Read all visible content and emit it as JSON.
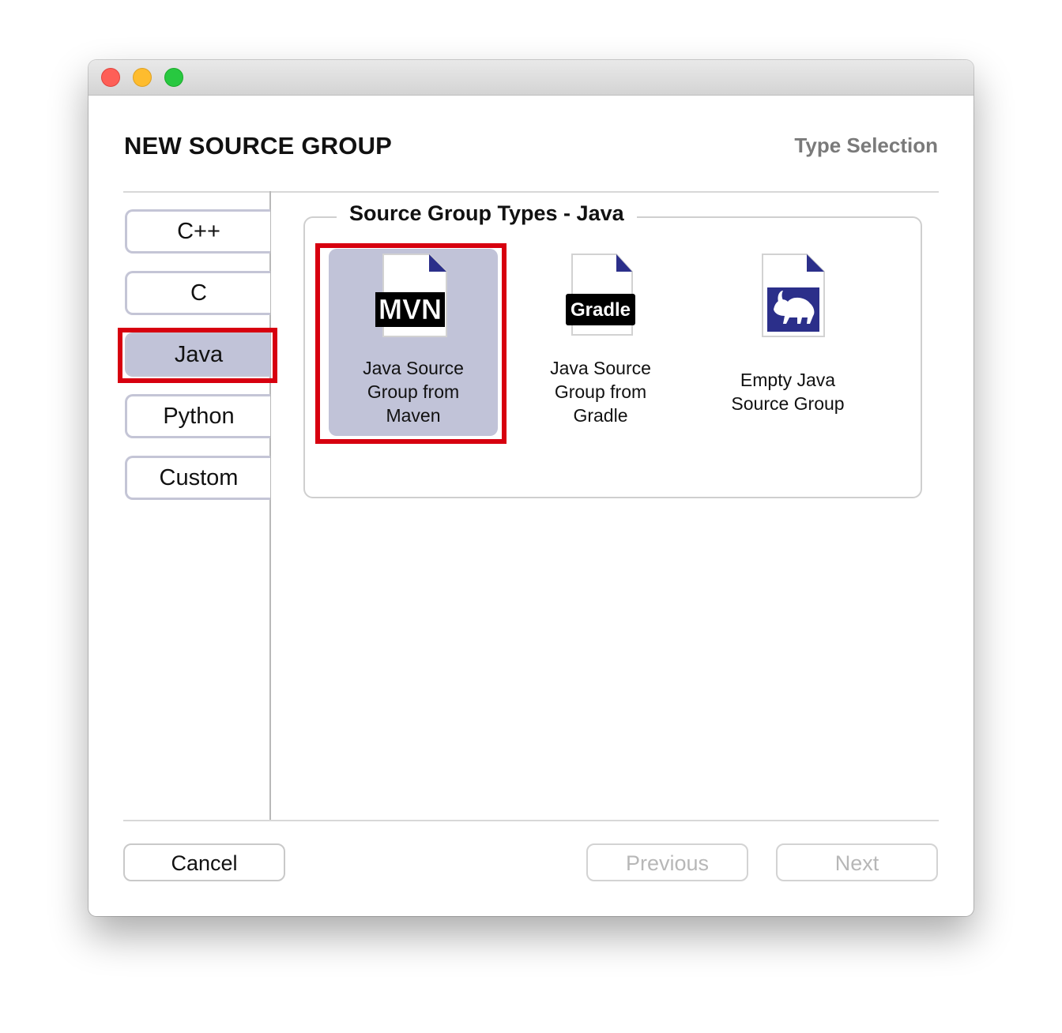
{
  "window": {
    "traffic_lights": [
      "close",
      "minimize",
      "maximize"
    ]
  },
  "header": {
    "title": "NEW SOURCE GROUP",
    "step": "Type Selection"
  },
  "languages": {
    "items": [
      {
        "label": "C++",
        "selected": false
      },
      {
        "label": "C",
        "selected": false
      },
      {
        "label": "Java",
        "selected": true
      },
      {
        "label": "Python",
        "selected": false
      },
      {
        "label": "Custom",
        "selected": false
      }
    ]
  },
  "types": {
    "legend": "Source Group Types - Java",
    "items": [
      {
        "label": "Java Source\nGroup from\nMaven",
        "badge": "MVN",
        "icon": "maven-document-icon",
        "selected": true
      },
      {
        "label": "Java Source\nGroup from\nGradle",
        "badge": "Gradle",
        "icon": "gradle-document-icon",
        "selected": false
      },
      {
        "label": "Empty Java\nSource Group",
        "badge": "",
        "icon": "ant-document-icon",
        "selected": false
      }
    ]
  },
  "footer": {
    "cancel": "Cancel",
    "previous": "Previous",
    "next": "Next",
    "previous_enabled": false,
    "next_enabled": false
  },
  "colors": {
    "selection": "#c1c3d8",
    "highlight": "#d7000f",
    "icon_corner": "#2b2f8a"
  }
}
